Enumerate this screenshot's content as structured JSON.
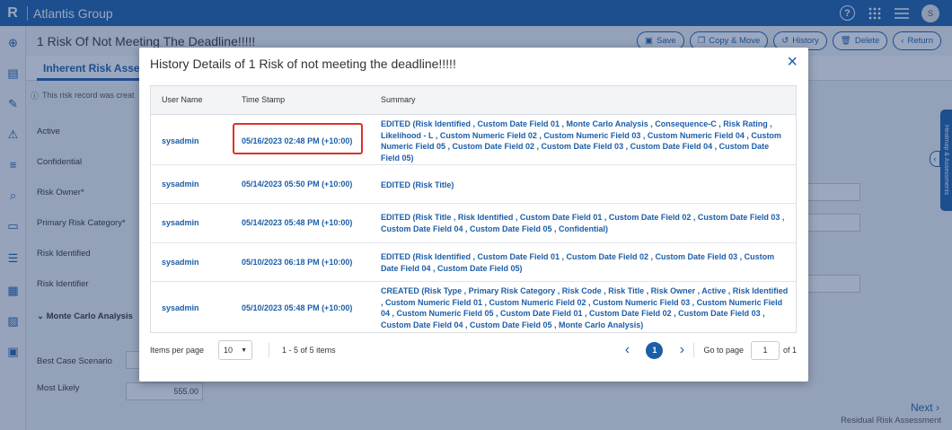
{
  "app": {
    "logo": "R",
    "name": "Atlantis Group",
    "avatar_initial": "S"
  },
  "page": {
    "title": "1 Risk Of Not Meeting The Deadline!!!!!"
  },
  "actions": [
    {
      "icon": "save-icon",
      "label": "Save"
    },
    {
      "icon": "copy-icon",
      "label": "Copy & Move"
    },
    {
      "icon": "history-icon",
      "label": "History"
    },
    {
      "icon": "trash-icon",
      "label": "Delete"
    },
    {
      "icon": "back-icon",
      "label": "Return"
    }
  ],
  "tab": {
    "label": "Inherent Risk Assessm"
  },
  "info": {
    "text": "This risk record was creat"
  },
  "form": {
    "active": "Active",
    "confidential": "Confidential",
    "risk_owner": "Risk Owner",
    "primary_category": "Primary Risk Category",
    "risk_identified": "Risk Identified",
    "risk_identifier": "Risk Identifier",
    "monte_carlo": "Monte Carlo Analysis",
    "best_case": "Best Case Scenario",
    "most_likely": "Most Likely",
    "most_likely_value": "555.00",
    "required_mark": "*"
  },
  "side_tab": {
    "label": "Heatmap & Assessments"
  },
  "footer": {
    "next": "Next",
    "next_sub": "Residual Risk Assessment"
  },
  "modal": {
    "title": "History Details of 1 Risk of not meeting the deadline!!!!!",
    "columns": {
      "user": "User Name",
      "time": "Time Stamp",
      "summary": "Summary"
    },
    "rows": [
      {
        "user": "sysadmin",
        "time": "05/16/2023 02:48 PM (+10:00)",
        "summary": "EDITED (Risk Identified , Custom Date Field 01 , Monte Carlo Analysis , Consequence-C , Risk Rating , Likelihood - L , Custom Numeric Field 02 , Custom Numeric Field 03 , Custom Numeric Field 04 , Custom Numeric Field 05 , Custom Date Field 02 , Custom Date Field 03 , Custom Date Field 04 , Custom Date Field 05)"
      },
      {
        "user": "sysadmin",
        "time": "05/14/2023 05:50 PM (+10:00)",
        "summary": "EDITED (Risk Title)"
      },
      {
        "user": "sysadmin",
        "time": "05/14/2023 05:48 PM (+10:00)",
        "summary": "EDITED (Risk Title , Risk Identified , Custom Date Field 01 , Custom Date Field 02 , Custom Date Field 03 , Custom Date Field 04 , Custom Date Field 05 , Confidential)"
      },
      {
        "user": "sysadmin",
        "time": "05/10/2023 06:18 PM (+10:00)",
        "summary": "EDITED (Risk Identified , Custom Date Field 01 , Custom Date Field 02 , Custom Date Field 03 , Custom Date Field 04 , Custom Date Field 05)"
      },
      {
        "user": "sysadmin",
        "time": "05/10/2023 05:48 PM (+10:00)",
        "summary": "CREATED (Risk Type , Primary Risk Category , Risk Code , Risk Title , Risk Owner , Active , Risk Identified , Custom Numeric Field 01 , Custom Numeric Field 02 , Custom Numeric Field 03 , Custom Numeric Field 04 , Custom Numeric Field 05 , Custom Date Field 01 , Custom Date Field 02 , Custom Date Field 03 , Custom Date Field 04 , Custom Date Field 05 , Monte Carlo Analysis)"
      }
    ],
    "pager": {
      "items_per_page_label": "Items per page",
      "items_per_page": "10",
      "range": "1 - 5 of 5 items",
      "current_page": "1",
      "goto_label": "Go to page",
      "goto_value": "1",
      "of_label": "of 1"
    }
  }
}
